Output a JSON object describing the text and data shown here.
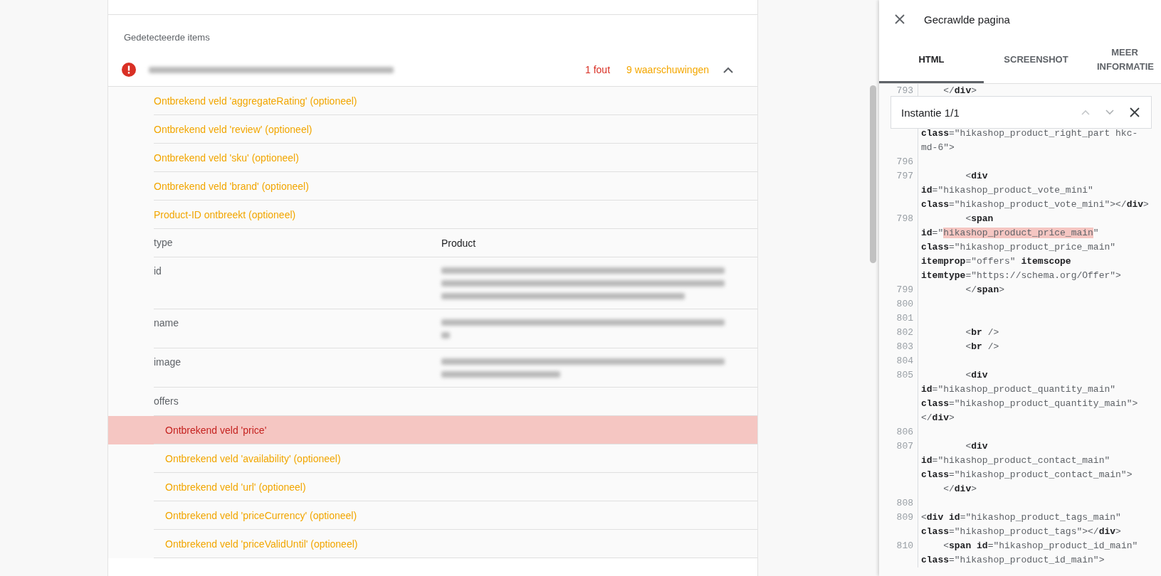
{
  "detail": {
    "section_title": "Gedetecteerde items",
    "item": {
      "title": {
        "kind": "blurred",
        "lines": [
          {
            "level": 0.86
          }
        ]
      },
      "error_count": "1 fout",
      "warning_count": "9 waarschuwingen",
      "expanded": true
    },
    "issues": [
      {
        "text": "Ontbrekend veld 'aggregateRating' (optioneel)",
        "kind": "warning",
        "selected": false
      },
      {
        "text": "Ontbrekend veld 'review' (optioneel)",
        "kind": "warning",
        "selected": false
      },
      {
        "text": "Ontbrekend veld 'sku' (optioneel)",
        "kind": "warning",
        "selected": false
      },
      {
        "text": "Ontbrekend veld 'brand' (optioneel)",
        "kind": "warning",
        "selected": false
      },
      {
        "text": "Product-ID ontbreekt (optioneel)",
        "kind": "warning",
        "selected": false
      }
    ],
    "properties": [
      {
        "name": "type",
        "value": {
          "kind": "text",
          "text": "Product"
        }
      },
      {
        "name": "id",
        "value": {
          "kind": "blurred",
          "lines": [
            {
              "level": 1
            },
            {
              "level": 1
            },
            {
              "level": 0.86
            }
          ]
        }
      },
      {
        "name": "name",
        "value": {
          "kind": "blurred",
          "lines": [
            {
              "level": 1
            },
            {
              "level": 0.03
            }
          ]
        }
      },
      {
        "name": "image",
        "value": {
          "kind": "blurred",
          "lines": [
            {
              "level": 1
            },
            {
              "level": 0.42
            }
          ]
        }
      },
      {
        "name": "offers",
        "issues": [
          {
            "text": "Ontbrekend veld 'price'",
            "kind": "error",
            "selected": true
          },
          {
            "text": "Ontbrekend veld 'availability' (optioneel)",
            "kind": "warning",
            "selected": false
          },
          {
            "text": "Ontbrekend veld 'url' (optioneel)",
            "kind": "warning",
            "selected": false
          },
          {
            "text": "Ontbrekend veld 'priceCurrency' (optioneel)",
            "kind": "warning",
            "selected": false
          },
          {
            "text": "Ontbrekend veld 'priceValidUntil' (optioneel)",
            "kind": "warning",
            "selected": false
          }
        ]
      }
    ]
  },
  "panel": {
    "title": "Gecrawlde pagina",
    "tabs": [
      {
        "label": "HTML",
        "selected": true
      },
      {
        "label": "SCREENSHOT",
        "selected": false
      },
      {
        "label": "MEER INFORMATIE",
        "selected": false
      }
    ],
    "find_bar": {
      "text": "Instantie 1/1"
    },
    "code_lines": [
      {
        "number": "793",
        "code": "    </**div**>"
      },
      {
        "code": "**class**=\"hikashop_product_right_part hkc-"
      },
      {
        "code": "md-6\">"
      },
      {
        "number": "796"
      },
      {
        "number": "797",
        "code": "        <**div**"
      },
      {
        "code": "**id**=\"hikashop_product_vote_mini\""
      },
      {
        "code": "**class**=\"hikashop_product_vote_mini\"></**div**>"
      },
      {
        "number": "798",
        "code": "        <**span**"
      },
      {
        "code": "**id**=\"",
        "match": "hikashop_product_price_main",
        "after": "\""
      },
      {
        "code": "**class**=\"hikashop_product_price_main\""
      },
      {
        "code": "**itemprop**=\"offers\" **itemscope**"
      },
      {
        "code": "**itemtype**=\"https://schema.org/Offer\">"
      },
      {
        "number": "799",
        "code": "        </**span**>"
      },
      {
        "number": "800"
      },
      {
        "number": "801"
      },
      {
        "number": "802",
        "code": "        <**br** />"
      },
      {
        "number": "803",
        "code": "        <**br** />"
      },
      {
        "number": "804"
      },
      {
        "number": "805",
        "code": "        <**div**"
      },
      {
        "code": "**id**=\"hikashop_product_quantity_main\""
      },
      {
        "code": "**class**=\"hikashop_product_quantity_main\">"
      },
      {
        "code": "</**div**>"
      },
      {
        "number": "806"
      },
      {
        "number": "807",
        "code": "        <**div**"
      },
      {
        "code": "**id**=\"hikashop_product_contact_main\""
      },
      {
        "code": "**class**=\"hikashop_product_contact_main\">"
      },
      {
        "code": "    </**div**>"
      },
      {
        "number": "808"
      },
      {
        "number": "809",
        "code": "<**div** **id**=\"hikashop_product_tags_main\""
      },
      {
        "code": "**class**=\"hikashop_product_tags\"></**div**>"
      },
      {
        "number": "810",
        "code": "    <**span** **id**=\"hikashop_product_id_main\""
      },
      {
        "code": "**class**=\"hikashop_product_id_main\">"
      }
    ]
  }
}
